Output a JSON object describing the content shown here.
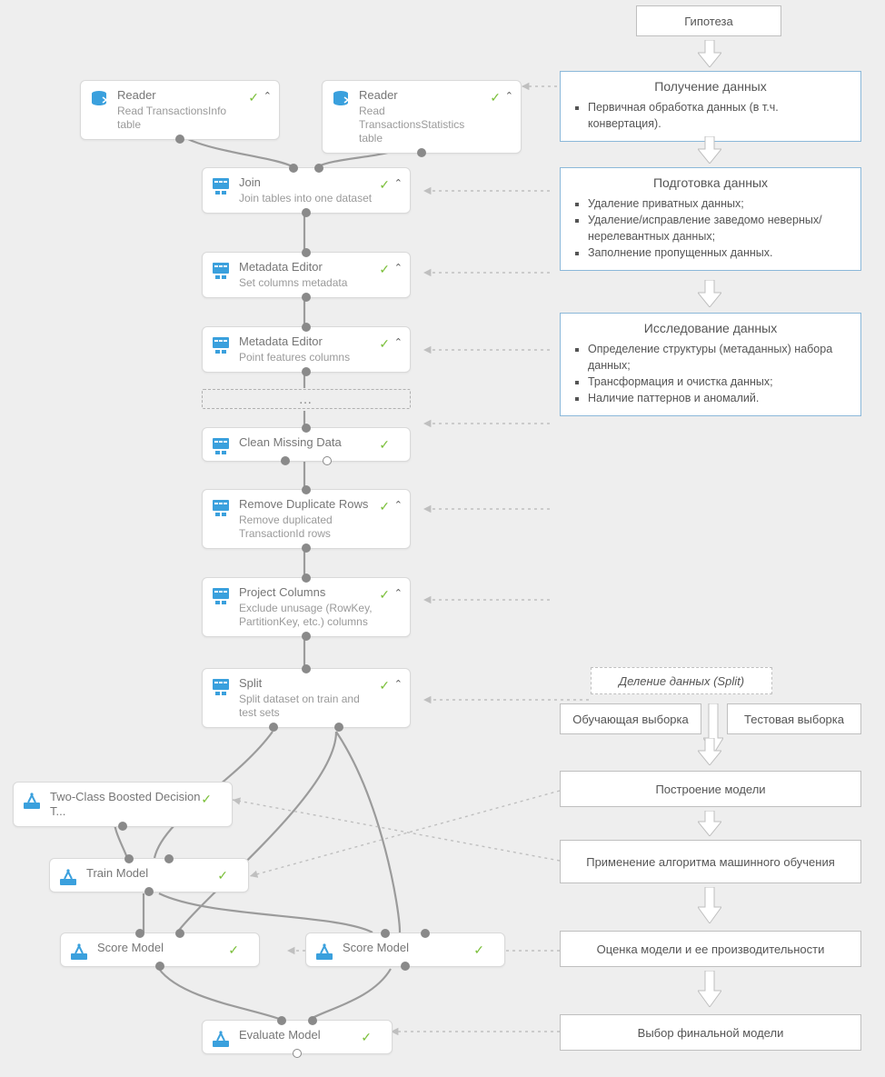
{
  "nodes": {
    "reader1": {
      "title": "Reader",
      "sub": "Read TransactionsInfo table"
    },
    "reader2": {
      "title": "Reader",
      "sub": "Read TransactionsStatistics table"
    },
    "join": {
      "title": "Join",
      "sub": "Join tables into one dataset"
    },
    "meta1": {
      "title": "Metadata Editor",
      "sub": "Set columns metadata"
    },
    "meta2": {
      "title": "Metadata Editor",
      "sub": "Point features columns"
    },
    "ellipsis": "…",
    "clean": {
      "title": "Clean Missing Data",
      "sub": ""
    },
    "dedup": {
      "title": "Remove Duplicate Rows",
      "sub": "Remove duplicated TransactionId rows"
    },
    "project": {
      "title": "Project Columns",
      "sub": "Exclude unusage (RowKey, PartitionKey, etc.)  columns"
    },
    "split": {
      "title": "Split",
      "sub": "Split dataset on train and test sets"
    },
    "algo": {
      "title": "Two-Class Boosted Decision T...",
      "sub": ""
    },
    "train": {
      "title": "Train Model",
      "sub": ""
    },
    "score1": {
      "title": "Score Model",
      "sub": ""
    },
    "score2": {
      "title": "Score Model",
      "sub": ""
    },
    "eval": {
      "title": "Evaluate Model",
      "sub": ""
    }
  },
  "flow": {
    "hypothesis": "Гипотеза",
    "ingest_title": "Получение данных",
    "ingest_items": [
      "Первичная обработка данных (в т.ч. конвертация)."
    ],
    "prep_title": "Подготовка данных",
    "prep_items": [
      "Удаление приватных данных;",
      "Удаление/исправление заведомо неверных/нерелевантных данных;",
      "Заполнение пропущенных данных."
    ],
    "explore_title": "Исследование данных",
    "explore_items": [
      "Определение структуры (метаданных) набора данных;",
      "Трансформация и очистка данных;",
      "Наличие паттернов и аномалий."
    ],
    "split_label": "Деление данных (Split)",
    "train_set": "Обучающая выборка",
    "test_set": "Тестовая выборка",
    "build": "Построение модели",
    "apply_algo": "Применение алгоритма машинного обучения",
    "evaluate": "Оценка модели и ее производительности",
    "final": "Выбор финальной модели"
  }
}
